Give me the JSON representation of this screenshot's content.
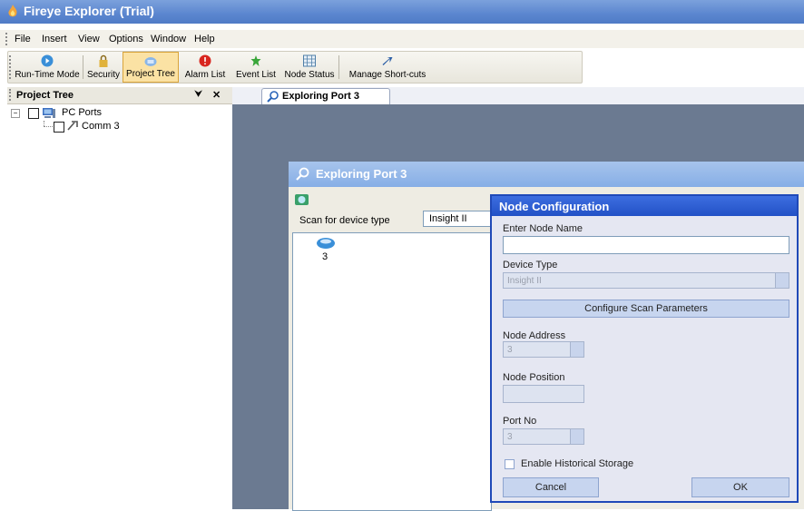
{
  "window": {
    "title": "Fireye Explorer (Trial)"
  },
  "menu": [
    "File",
    "Insert",
    "View",
    "Options",
    "Window",
    "Help"
  ],
  "toolbar": {
    "runtime": "Run-Time Mode",
    "security": "Security",
    "project_tree": "Project Tree",
    "alarm_list": "Alarm List",
    "event_list": "Event List",
    "node_status": "Node Status",
    "manage_shortcuts": "Manage Short-cuts"
  },
  "left_panel": {
    "title": "Project Tree",
    "pin": "⮟",
    "close": "✕",
    "tree": {
      "root": "PC Ports",
      "child": "Comm 3"
    }
  },
  "tab": {
    "label": "Exploring Port 3"
  },
  "explore": {
    "title": "Exploring Port 3",
    "scan_label": "Scan for device type",
    "scan_value": "Insight II",
    "device_number": "3"
  },
  "dialog": {
    "title": "Node Configuration",
    "node_name_label": "Enter Node Name",
    "node_name_value": "",
    "device_type_label": "Device Type",
    "device_type_value": "Insight II",
    "configure_button": "Configure Scan Parameters",
    "node_address_label": "Node Address",
    "node_address_value": "3",
    "node_position_label": "Node Position",
    "node_position_value": "",
    "port_label": "Port No",
    "port_value": "3",
    "historical_label": "Enable Historical Storage",
    "historical_checked": false,
    "cancel": "Cancel",
    "ok": "OK"
  },
  "colors": {
    "title_blue": "#5b86cf",
    "dialog_blue": "#2251c6",
    "workspace": "#6b7a91"
  }
}
